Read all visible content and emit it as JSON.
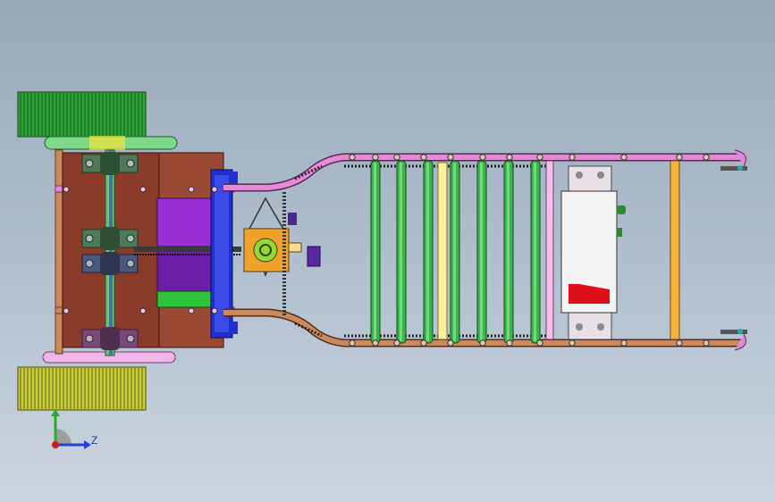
{
  "viewport": {
    "background_top": "#98a9ba",
    "background_bottom": "#cbd5df",
    "view": "top-view-isometric-cad"
  },
  "model": {
    "name": "vehicle-chassis-assembly",
    "colors": {
      "rail_pink": "#e58ad6",
      "rail_copper": "#c98a5e",
      "crossbar_green": "#3cb44b",
      "crossbar_yellow": "#f2b43a",
      "plate_brown": "#8a3b2a",
      "wheel_green": "#2fa43a",
      "wheel_yellow": "#c9cf3a",
      "motor_purple": "#9b2fd6",
      "mount_blue": "#1f2fd0",
      "gearbox_orange": "#f0a12a",
      "battery_white": "#f4f4f4",
      "battery_red": "#e0101a"
    },
    "crossbar_count": 7
  },
  "triad": {
    "z_label": "Z",
    "icons": [
      "y-axis-arrow-icon",
      "z-axis-arrow-icon",
      "origin-icon"
    ]
  }
}
